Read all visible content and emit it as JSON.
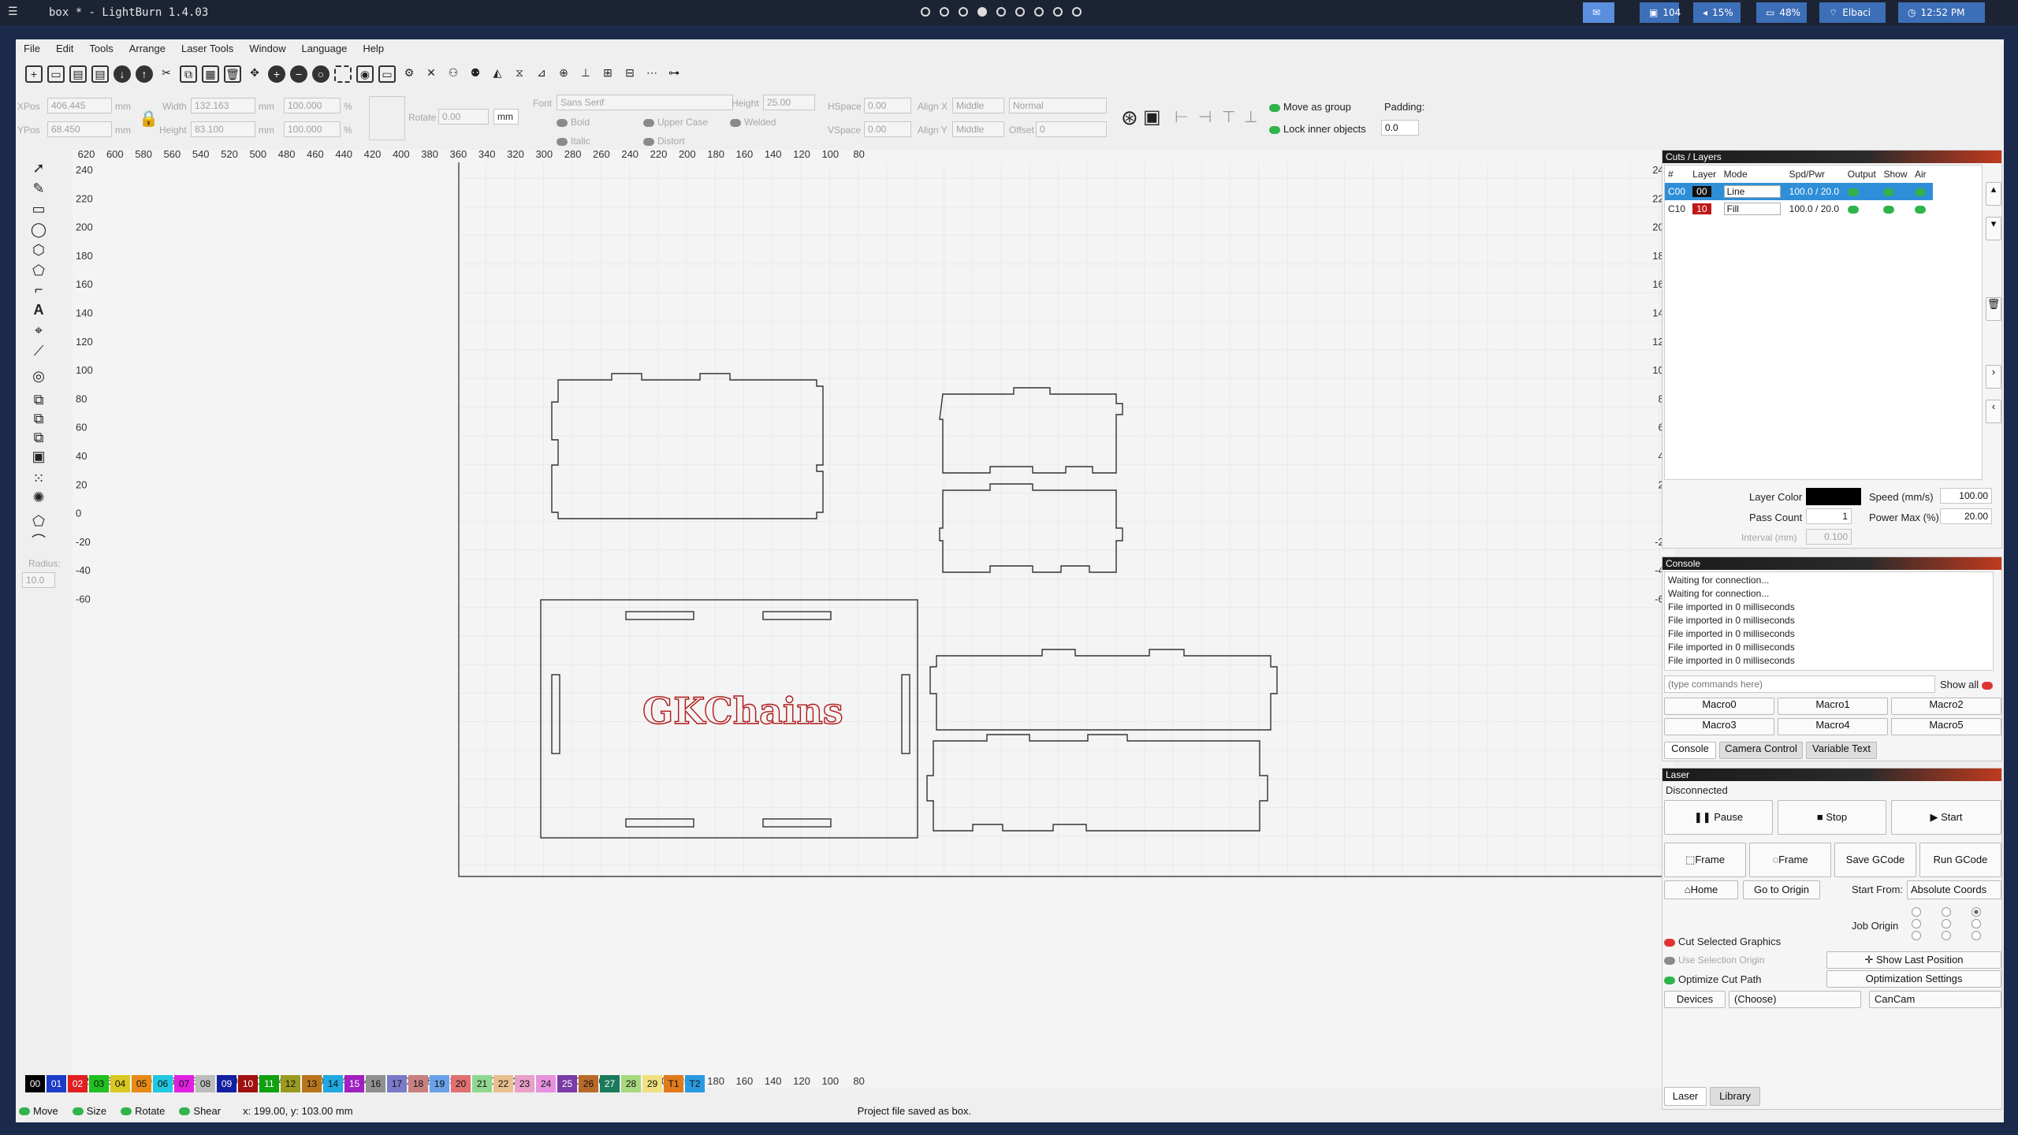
{
  "system_bar": {
    "window_title": "box * - LightBurn 1.4.03",
    "workspaces": [
      false,
      false,
      false,
      true,
      false,
      false,
      false,
      false,
      false
    ],
    "tray": [
      {
        "icon": "chat-icon",
        "text": ""
      },
      {
        "icon": "memory-icon",
        "text": "104"
      },
      {
        "icon": "volume-icon",
        "text": "15%"
      },
      {
        "icon": "battery-icon",
        "text": "48%"
      },
      {
        "icon": "wifi-icon",
        "text": "Elbaci"
      },
      {
        "icon": "clock-icon",
        "text": "12:52 PM"
      }
    ]
  },
  "menu": [
    "File",
    "Edit",
    "Tools",
    "Arrange",
    "Laser Tools",
    "Window",
    "Language",
    "Help"
  ],
  "toolbar2": {
    "xpos_label": "XPos",
    "xpos_value": "406.445",
    "ypos_label": "YPos",
    "ypos_value": "68.450",
    "width_label": "Width",
    "width_value": "132.163",
    "height_label": "Height",
    "height_value": "83.100",
    "scale_w": "100.000",
    "scale_h": "100.000",
    "unit_mm": "mm",
    "unit_pct": "%",
    "rotate_label": "Rotate",
    "rotate_value": "0.00",
    "rotate_unit": "mm",
    "font_label": "Font",
    "font_value": "Sans Serif",
    "font_height_label": "Height",
    "font_height_value": "25.00",
    "hspace_label": "HSpace",
    "hspace_value": "0.00",
    "vspace_label": "VSpace",
    "vspace_value": "0.00",
    "alignx_label": "Align X",
    "alignx_value": "Middle",
    "aligny_label": "Align Y",
    "aligny_value": "Middle",
    "style_value": "Normal",
    "offset_label": "Offset",
    "offset_value": "0",
    "bold": "Bold",
    "italic": "Italic",
    "upper_case": "Upper Case",
    "distort": "Distort",
    "welded": "Welded",
    "move_as_group": "Move as group",
    "lock_inner": "Lock inner objects",
    "padding_label": "Padding:",
    "padding_value": "0.0"
  },
  "left_tools": {
    "radius_label": "Radius:",
    "radius_value": "10.0"
  },
  "canvas": {
    "x_ticks": [
      "620",
      "600",
      "580",
      "560",
      "540",
      "520",
      "500",
      "480",
      "460",
      "440",
      "420",
      "400",
      "380",
      "360",
      "340",
      "320",
      "300",
      "280",
      "260",
      "240",
      "220",
      "200",
      "180",
      "160",
      "140",
      "120",
      "100",
      "80"
    ],
    "y_ticks": [
      "240",
      "220",
      "200",
      "180",
      "160",
      "140",
      "120",
      "100",
      "80",
      "60",
      "40",
      "20",
      "0",
      "-20",
      "-40",
      "-60"
    ],
    "text_object": "GKChains"
  },
  "layers_panel": {
    "title": "Cuts / Layers",
    "headers": [
      "#",
      "Layer",
      "Mode",
      "Spd/Pwr",
      "Output",
      "Show",
      "Air"
    ],
    "rows": [
      {
        "id": "C00",
        "layer": "00",
        "color": "#111111",
        "mode": "Line",
        "spdpwr": "100.0 / 20.0"
      },
      {
        "id": "C10",
        "layer": "10",
        "color": "#c01818",
        "mode": "Fill",
        "spdpwr": "100.0 / 20.0"
      }
    ],
    "layer_color_label": "Layer Color",
    "speed_label": "Speed (mm/s)",
    "speed_value": "100.00",
    "pass_label": "Pass Count",
    "pass_value": "1",
    "power_label": "Power Max (%)",
    "power_value": "20.00",
    "interval_label": "Interval (mm)",
    "interval_value": "0.100"
  },
  "console": {
    "title": "Console",
    "lines": [
      "Waiting for connection...",
      "Waiting for connection...",
      "File imported in 0 milliseconds",
      "File imported in 0 milliseconds",
      "File imported in 0 milliseconds",
      "File imported in 0 milliseconds",
      "File imported in 0 milliseconds"
    ],
    "input_placeholder": "(type commands here)",
    "show_all": "Show all",
    "macros": [
      "Macro0",
      "Macro1",
      "Macro2",
      "Macro3",
      "Macro4",
      "Macro5"
    ],
    "tabs": [
      "Console",
      "Camera Control",
      "Variable Text"
    ]
  },
  "laser": {
    "title": "Laser",
    "status": "Disconnected",
    "pause": "Pause",
    "stop": "Stop",
    "start": "Start",
    "frame1": "Frame",
    "frame2": "Frame",
    "save_gcode": "Save GCode",
    "run_gcode": "Run GCode",
    "home": "Home",
    "go_origin": "Go to Origin",
    "start_from_label": "Start From:",
    "start_from_value": "Absolute Coords",
    "job_origin_label": "Job Origin",
    "cut_selected": "Cut Selected Graphics",
    "use_selection_origin": "Use Selection Origin",
    "optimize_cut": "Optimize Cut Path",
    "show_last": "Show Last Position",
    "opt_settings": "Optimization Settings",
    "devices": "Devices",
    "choose": "(Choose)",
    "device": "CanCam",
    "tabs": [
      "Laser",
      "Library"
    ]
  },
  "palette": [
    {
      "n": "00",
      "c": "#000000",
      "t": "#fff"
    },
    {
      "n": "01",
      "c": "#1a3cc8",
      "t": "#fff"
    },
    {
      "n": "02",
      "c": "#e02020",
      "t": "#fff"
    },
    {
      "n": "03",
      "c": "#20c020",
      "t": "#111"
    },
    {
      "n": "04",
      "c": "#d8c820",
      "t": "#111"
    },
    {
      "n": "05",
      "c": "#e88a18",
      "t": "#111"
    },
    {
      "n": "06",
      "c": "#20c8e0",
      "t": "#111"
    },
    {
      "n": "07",
      "c": "#e020e0",
      "t": "#111"
    },
    {
      "n": "08",
      "c": "#bcbcbc",
      "t": "#111"
    },
    {
      "n": "09",
      "c": "#1020a0",
      "t": "#fff"
    },
    {
      "n": "10",
      "c": "#a01010",
      "t": "#fff"
    },
    {
      "n": "11",
      "c": "#10a010",
      "t": "#fff"
    },
    {
      "n": "12",
      "c": "#9a9a20",
      "t": "#111"
    },
    {
      "n": "13",
      "c": "#b8741a",
      "t": "#111"
    },
    {
      "n": "14",
      "c": "#20a8e0",
      "t": "#111"
    },
    {
      "n": "15",
      "c": "#a020c0",
      "t": "#fff"
    },
    {
      "n": "16",
      "c": "#909090",
      "t": "#111"
    },
    {
      "n": "17",
      "c": "#7a7ac8",
      "t": "#111"
    },
    {
      "n": "18",
      "c": "#c88080",
      "t": "#111"
    },
    {
      "n": "19",
      "c": "#6aa0e8",
      "t": "#111"
    },
    {
      "n": "20",
      "c": "#e07070",
      "t": "#111"
    },
    {
      "n": "21",
      "c": "#90d890",
      "t": "#111"
    },
    {
      "n": "22",
      "c": "#e8c090",
      "t": "#111"
    },
    {
      "n": "23",
      "c": "#e8a0c8",
      "t": "#111"
    },
    {
      "n": "24",
      "c": "#e890e0",
      "t": "#111"
    },
    {
      "n": "25",
      "c": "#7a3aa8",
      "t": "#fff"
    },
    {
      "n": "26",
      "c": "#b86a2a",
      "t": "#111"
    },
    {
      "n": "27",
      "c": "#1a7a5a",
      "t": "#fff"
    },
    {
      "n": "28",
      "c": "#a8d880",
      "t": "#111"
    },
    {
      "n": "29",
      "c": "#f0e080",
      "t": "#111"
    },
    {
      "n": "T1",
      "c": "#e07a1a",
      "t": "#111"
    },
    {
      "n": "T2",
      "c": "#2a9ae0",
      "t": "#111"
    }
  ],
  "status_bar": {
    "move": "Move",
    "size": "Size",
    "rotate": "Rotate",
    "shear": "Shear",
    "coords": "x: 199.00, y: 103.00 mm",
    "message": "Project file saved as box."
  }
}
